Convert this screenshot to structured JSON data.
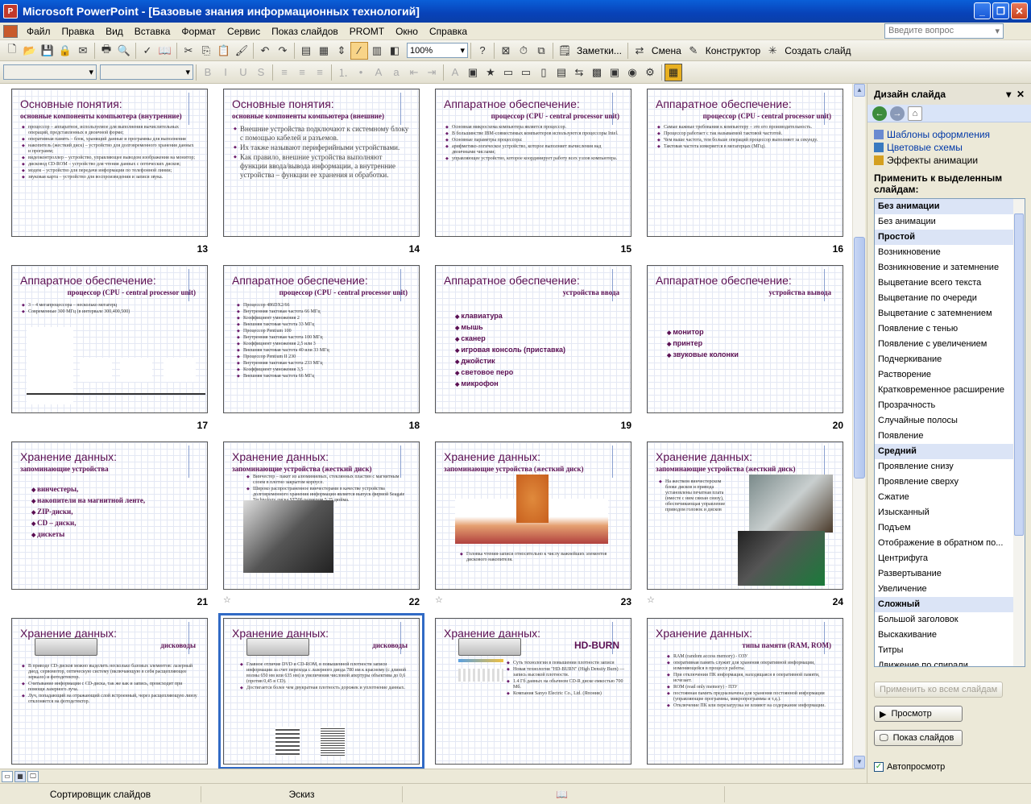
{
  "window": {
    "title": "Microsoft PowerPoint - [Базовые знания информационных технологий]"
  },
  "menu": [
    "Файл",
    "Правка",
    "Вид",
    "Вставка",
    "Формат",
    "Сервис",
    "Показ слайдов",
    "PROMT",
    "Окно",
    "Справка"
  ],
  "help_placeholder": "Введите вопрос",
  "toolbar": {
    "zoom": "100%",
    "notes": "Заметки...",
    "change": "Смена",
    "designer": "Конструктор",
    "new_slide": "Создать слайд"
  },
  "slides": [
    {
      "n": "13",
      "title": "Основные понятия:",
      "subtitle": "основные компоненты компьютера (внутренние)",
      "star": false,
      "body": [
        "процессор – аппаратное, используемое для выполнения вычислительных операций, представленных в двоичной форме;",
        "оперативная память – блок, хранящий данные и программы для выполнения",
        "накопитель (жесткий диск) – устройство для долговременного хранения данных и программ;",
        "видеоконтроллер – устройство, управляющее выводом изображения на монитор;",
        "дисковод CD-ROM – устройство для чтения данных с оптических дисков;",
        "модем – устройство для передачи информации по телефонной линии;",
        "звуковая карта – устройство для воспроизведения и записи звука."
      ]
    },
    {
      "n": "14",
      "title": "Основные понятия:",
      "subtitle": "основные компоненты компьютера (внешние)",
      "star": false,
      "body": [
        "Внешние устройства подключают к системному блоку с помощью кабелей и разъемов.",
        "Их также называют периферийными устройствами.",
        "Как правило, внешние устройства выполняют функции ввода/вывода информации, а внутренние устройства – функции ее хранения и обработки."
      ]
    },
    {
      "n": "15",
      "title": "Аппаратное обеспечение:",
      "subtitle": "процессор (CPU - central processor unit)",
      "star": false,
      "body": [
        "Основная микросхема компьютера является процессор.",
        "В большинстве IBM-совместимых компьютеров используются процессоры Intel.",
        "Основные параметры процессора:",
        "арифметико-логическое устройство, которое выполняет вычисления над двоичными числами;",
        "управляющее устройство, которое координирует работу всех узлов компьютера."
      ]
    },
    {
      "n": "16",
      "title": "Аппаратное обеспечение:",
      "subtitle": "процессор (CPU - central processor unit)",
      "star": false,
      "body": [
        "Самые важные требования к компьютеру – это его производительность.",
        "Процессор работает с так называемой тактовой частотой.",
        "Чем выше частота, тем больше операций процессор выполняет за секунду.",
        "Тактовая частота измеряется в мегагерцах (МГц)."
      ]
    },
    {
      "n": "17",
      "title": "Аппаратное обеспечение:",
      "subtitle": "процессор (CPU - central processor unit)",
      "star": false,
      "body": [
        "3 – 4 мегапроцессора – несколько мегагерц",
        "Современные 300 МГц (в интервале 300,400,500)"
      ]
    },
    {
      "n": "18",
      "title": "Аппаратное обеспечение:",
      "subtitle": "процессор (CPU - central processor unit)",
      "star": false,
      "body": [
        "Процессор 486DX2/66",
        "Внутренняя тактовая частота 66 МГц",
        "Коэффициент умножения 2",
        "Внешняя тактовая частота 33 МГц",
        "Процессор Pentium 100",
        "Внутренняя тактовая частота 100 МГц",
        "Коэффициент умножения 2,5 или 3",
        "Внешняя тактовая частота 40 или 33 МГц",
        "Процессор Pentium II 230",
        "Внутренняя тактовая частота 233 МГц",
        "Коэффициент умножения 3,5",
        "Внешняя тактовая частота 66 МГц"
      ]
    },
    {
      "n": "19",
      "title": "Аппаратное обеспечение:",
      "subtitle": "устройства ввода",
      "star": false,
      "body": [
        "клавиатура",
        "мышь",
        "сканер",
        "игровая консоль (приставка)",
        "джойстик",
        "световое перо",
        "микрофон"
      ]
    },
    {
      "n": "20",
      "title": "Аппаратное обеспечение:",
      "subtitle": "устройства вывода",
      "star": false,
      "body": [
        "монитор",
        "принтер",
        "звуковые колонки"
      ]
    },
    {
      "n": "21",
      "title": "Хранение данных:",
      "subtitle": "запоминающие устройства",
      "star": false,
      "body": [
        "винчестеры,",
        "накопители на магнитной ленте,",
        "ZIP-диски,",
        "CD – диски,",
        "дискеты"
      ]
    },
    {
      "n": "22",
      "title": "Хранение данных:",
      "subtitle": "запоминающие устройства (жесткий диск)",
      "star": true,
      "body": [
        "Винчестер – пакет из алюминиевых, стеклянных пластин с магнитным слоем в плотно закрытом корпусе.",
        "Широко распространенное винчестерами в качестве устройства долговременного хранения информации является выпуск фирмой Seagate Technology диска ST506 размером 5.25 дюйма."
      ]
    },
    {
      "n": "23",
      "title": "Хранение данных:",
      "subtitle": "запоминающие устройства (жесткий диск)",
      "star": true,
      "body": [
        "Головка чтения-записи относительно к числу важнейших элементов дискового накопителя."
      ]
    },
    {
      "n": "24",
      "title": "Хранение данных:",
      "subtitle": "запоминающие устройства (жесткий диск)",
      "star": true,
      "body": [
        "На жестком винчестерском блоке дисков и привода установлены печатная плата (вместе с ним связан снизу), обеспечивающая управление приводом головок и дисков"
      ]
    },
    {
      "n": "25",
      "title": "Хранение данных:",
      "subtitle": "дисководы",
      "star": false,
      "body": [
        "В приводе CD-дисков можно выделить несколько базовых элементов: лазерный диод, сервомотор, оптическую систему (включающую в себя расщепляющее зеркало) и фотодетектор.",
        "Считывание информации с CD-диска, так же как и запись, происходит при помощи лазерного луча.",
        "Луч, попадающий на отражающий слой встроенный, через расщепляющую линзу отклоняется на фотодетектор."
      ]
    },
    {
      "n": "26",
      "title": "Хранение данных:",
      "subtitle": "дисководы",
      "star": false,
      "body": [
        "Главное отличие DVD и CD-ROM, в повышенной плотности записи информации за счет перехода с лазерного диода 780 нм к красному (с длиной волны 650 нм или 635 нм) и увеличения числовой апертуры объектива до 0,6 (против 0,45 в CD).",
        "Достигается более чем двукратная плотность дорожек и уплотнение данных."
      ]
    },
    {
      "n": "27",
      "title": "Хранение данных:",
      "subtitle": "HD-BURN",
      "star": false,
      "body": [
        "Суть технологии в повышении плотности записи",
        "Новая технология \"HD-BURN\" (High Density Burn) — запись высокой плотности.",
        "1.4 Гб данных на обычном CD-R диске емкостью 700 Мб.",
        "Компания Sanyo Electric Co., Ltd. (Япония)"
      ]
    },
    {
      "n": "28",
      "title": "Хранение данных:",
      "subtitle": "типы памяти (RAM, ROM)",
      "star": false,
      "body": [
        "RAM (random access memory) - ОЗУ",
        "оперативная память служит для хранения оперативной информации, изменяющейся в процессе работы.",
        "При отключении ПК информация, находящаяся в оперативной памяти, исчезает.",
        "ROM (read only memory) - ПЗУ",
        "постоянная память предназначена для хранения постоянной информации (управляющие программы, микропрограммы и т.д.).",
        "Отключение ПК или перезагрузка не влияют на содержание информации."
      ]
    }
  ],
  "taskpane": {
    "title": "Дизайн слайда",
    "links": [
      "Шаблоны оформления",
      "Цветовые схемы",
      "Эффекты анимации"
    ],
    "apply_label": "Применить к выделенным слайдам:",
    "items": [
      {
        "t": "Без анимации",
        "k": "hdr"
      },
      {
        "t": "Без анимации",
        "k": ""
      },
      {
        "t": "Простой",
        "k": "hdr"
      },
      {
        "t": "Возникновение",
        "k": ""
      },
      {
        "t": "Возникновение и затемнение",
        "k": ""
      },
      {
        "t": "Выцветание всего текста",
        "k": ""
      },
      {
        "t": "Выцветание по очереди",
        "k": ""
      },
      {
        "t": "Выцветание с затемнением",
        "k": ""
      },
      {
        "t": "Появление с тенью",
        "k": ""
      },
      {
        "t": "Появление с увеличением",
        "k": ""
      },
      {
        "t": "Подчеркивание",
        "k": ""
      },
      {
        "t": "Растворение",
        "k": ""
      },
      {
        "t": "Кратковременное расширение",
        "k": ""
      },
      {
        "t": "Прозрачность",
        "k": ""
      },
      {
        "t": "Случайные полосы",
        "k": ""
      },
      {
        "t": "Появление",
        "k": ""
      },
      {
        "t": "Средний",
        "k": "hdr"
      },
      {
        "t": "Проявление снизу",
        "k": ""
      },
      {
        "t": "Проявление сверху",
        "k": ""
      },
      {
        "t": "Сжатие",
        "k": ""
      },
      {
        "t": "Изысканный",
        "k": ""
      },
      {
        "t": "Подъем",
        "k": ""
      },
      {
        "t": "Отображение в обратном по...",
        "k": ""
      },
      {
        "t": "Центрифуга",
        "k": ""
      },
      {
        "t": "Развертывание",
        "k": ""
      },
      {
        "t": "Увеличение",
        "k": ""
      },
      {
        "t": "Сложный",
        "k": "hdr"
      },
      {
        "t": "Большой заголовок",
        "k": ""
      },
      {
        "t": "Выскакивание",
        "k": ""
      },
      {
        "t": "Титры",
        "k": ""
      },
      {
        "t": "Движение по спирали",
        "k": ""
      }
    ],
    "apply_all": "Применить ко всем слайдам",
    "preview": "Просмотр",
    "slideshow": "Показ слайдов",
    "autopreview": "Автопросмотр"
  },
  "status": {
    "view": "Сортировщик слайдов",
    "design": "Эскиз"
  }
}
